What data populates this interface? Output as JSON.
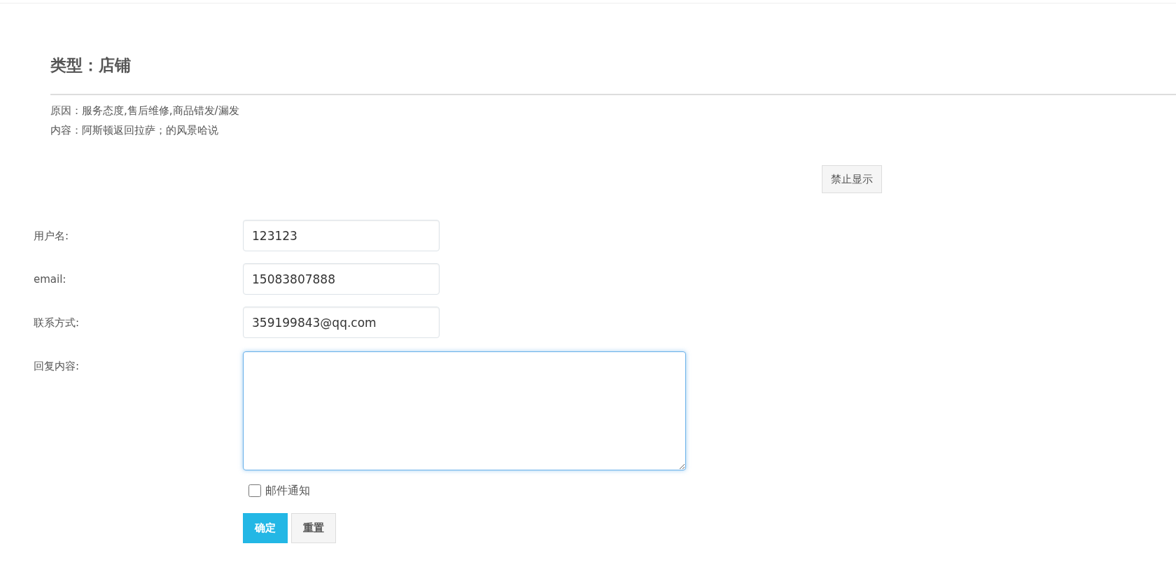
{
  "heading": "类型：店铺",
  "details": [
    "原因：服务态度,售后维修,商品错发/漏发",
    "内容：阿斯顿返回拉萨；的风景哈说"
  ],
  "hide_button": "禁止显示",
  "fields": [
    {
      "kind": "input",
      "label": "用户名:",
      "value": "123123"
    },
    {
      "kind": "input",
      "label": "email:",
      "value": "15083807888"
    },
    {
      "kind": "input",
      "label": "联系方式:",
      "value": "359199843@qq.com"
    },
    {
      "kind": "textarea",
      "label": "回复内容:",
      "focused": true
    }
  ],
  "notify": {
    "label": "邮件通知",
    "checked": false
  },
  "buttons": [
    {
      "kind": "primary",
      "label": "确定"
    },
    {
      "kind": "default",
      "label": "重置"
    }
  ]
}
